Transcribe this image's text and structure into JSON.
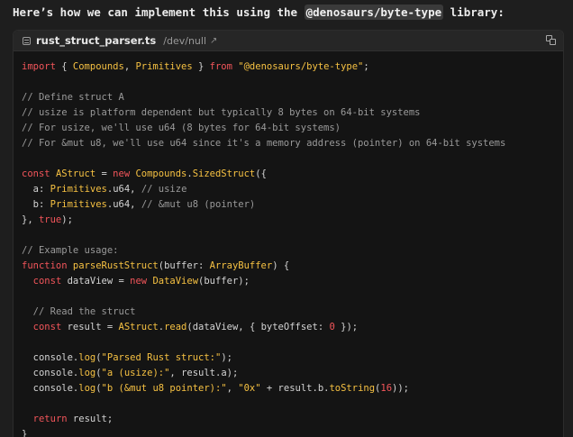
{
  "intro": {
    "before": "Here’s how we can implement this using the ",
    "package": "@denosaurs/byte-type",
    "after": " library:"
  },
  "codeblock": {
    "filename": "rust_struct_parser.ts",
    "path": "/dev/null",
    "path_icon": "external-link-icon",
    "copy_icon": "copy-icon"
  },
  "colors": {
    "keyword": "#f2555a",
    "type": "#f6c142",
    "string": "#f6c142",
    "comment": "#9a9a9a",
    "text": "#d4d4d4",
    "background": "#141414"
  },
  "code": [
    [
      [
        "kw",
        "import"
      ],
      [
        "pun",
        " { "
      ],
      [
        "ty",
        "Compounds"
      ],
      [
        "pun",
        ", "
      ],
      [
        "ty",
        "Primitives"
      ],
      [
        "pun",
        " } "
      ],
      [
        "kw",
        "from"
      ],
      [
        "pun",
        " "
      ],
      [
        "str",
        "\"@denosaurs/byte-type\""
      ],
      [
        "pun",
        ";"
      ]
    ],
    [],
    [
      [
        "com",
        "// Define struct A"
      ]
    ],
    [
      [
        "com",
        "// usize is platform dependent but typically 8 bytes on 64-bit systems"
      ]
    ],
    [
      [
        "com",
        "// For usize, we'll use u64 (8 bytes for 64-bit systems)"
      ]
    ],
    [
      [
        "com",
        "// For &mut u8, we'll use u64 since it's a memory address (pointer) on 64-bit systems"
      ]
    ],
    [],
    [
      [
        "kw",
        "const"
      ],
      [
        "pun",
        " "
      ],
      [
        "ty",
        "AStruct"
      ],
      [
        "pun",
        " = "
      ],
      [
        "kw",
        "new"
      ],
      [
        "pun",
        " "
      ],
      [
        "ty",
        "Compounds"
      ],
      [
        "pun",
        "."
      ],
      [
        "fn",
        "SizedStruct"
      ],
      [
        "pun",
        "({"
      ]
    ],
    [
      [
        "pun",
        "  "
      ],
      [
        "id",
        "a"
      ],
      [
        "pun",
        ": "
      ],
      [
        "ty",
        "Primitives"
      ],
      [
        "pun",
        "."
      ],
      [
        "id",
        "u64"
      ],
      [
        "pun",
        ", "
      ],
      [
        "com",
        "// usize"
      ]
    ],
    [
      [
        "pun",
        "  "
      ],
      [
        "id",
        "b"
      ],
      [
        "pun",
        ": "
      ],
      [
        "ty",
        "Primitives"
      ],
      [
        "pun",
        "."
      ],
      [
        "id",
        "u64"
      ],
      [
        "pun",
        ", "
      ],
      [
        "com",
        "// &mut u8 (pointer)"
      ]
    ],
    [
      [
        "pun",
        "}, "
      ],
      [
        "lit",
        "true"
      ],
      [
        "pun",
        ");"
      ]
    ],
    [],
    [
      [
        "com",
        "// Example usage:"
      ]
    ],
    [
      [
        "kw",
        "function"
      ],
      [
        "pun",
        " "
      ],
      [
        "fn",
        "parseRustStruct"
      ],
      [
        "pun",
        "("
      ],
      [
        "id",
        "buffer"
      ],
      [
        "pun",
        ": "
      ],
      [
        "ty",
        "ArrayBuffer"
      ],
      [
        "pun",
        ") {"
      ]
    ],
    [
      [
        "pun",
        "  "
      ],
      [
        "kw",
        "const"
      ],
      [
        "pun",
        " "
      ],
      [
        "id",
        "dataView"
      ],
      [
        "pun",
        " = "
      ],
      [
        "kw",
        "new"
      ],
      [
        "pun",
        " "
      ],
      [
        "ty",
        "DataView"
      ],
      [
        "pun",
        "("
      ],
      [
        "id",
        "buffer"
      ],
      [
        "pun",
        ");"
      ]
    ],
    [],
    [
      [
        "pun",
        "  "
      ],
      [
        "com",
        "// Read the struct"
      ]
    ],
    [
      [
        "pun",
        "  "
      ],
      [
        "kw",
        "const"
      ],
      [
        "pun",
        " "
      ],
      [
        "id",
        "result"
      ],
      [
        "pun",
        " = "
      ],
      [
        "ty",
        "AStruct"
      ],
      [
        "pun",
        "."
      ],
      [
        "fn",
        "read"
      ],
      [
        "pun",
        "("
      ],
      [
        "id",
        "dataView"
      ],
      [
        "pun",
        ", { "
      ],
      [
        "id",
        "byteOffset"
      ],
      [
        "pun",
        ": "
      ],
      [
        "num",
        "0"
      ],
      [
        "pun",
        " });"
      ]
    ],
    [],
    [
      [
        "pun",
        "  "
      ],
      [
        "id",
        "console"
      ],
      [
        "pun",
        "."
      ],
      [
        "fn",
        "log"
      ],
      [
        "pun",
        "("
      ],
      [
        "str",
        "\"Parsed Rust struct:\""
      ],
      [
        "pun",
        ");"
      ]
    ],
    [
      [
        "pun",
        "  "
      ],
      [
        "id",
        "console"
      ],
      [
        "pun",
        "."
      ],
      [
        "fn",
        "log"
      ],
      [
        "pun",
        "("
      ],
      [
        "str",
        "\"a (usize):\""
      ],
      [
        "pun",
        ", "
      ],
      [
        "id",
        "result"
      ],
      [
        "pun",
        "."
      ],
      [
        "id",
        "a"
      ],
      [
        "pun",
        ");"
      ]
    ],
    [
      [
        "pun",
        "  "
      ],
      [
        "id",
        "console"
      ],
      [
        "pun",
        "."
      ],
      [
        "fn",
        "log"
      ],
      [
        "pun",
        "("
      ],
      [
        "str",
        "\"b (&mut u8 pointer):\""
      ],
      [
        "pun",
        ", "
      ],
      [
        "str",
        "\"0x\""
      ],
      [
        "pun",
        " + "
      ],
      [
        "id",
        "result"
      ],
      [
        "pun",
        "."
      ],
      [
        "id",
        "b"
      ],
      [
        "pun",
        "."
      ],
      [
        "fn",
        "toString"
      ],
      [
        "pun",
        "("
      ],
      [
        "num",
        "16"
      ],
      [
        "pun",
        "));"
      ]
    ],
    [],
    [
      [
        "pun",
        "  "
      ],
      [
        "kw",
        "return"
      ],
      [
        "pun",
        " "
      ],
      [
        "id",
        "result"
      ],
      [
        "pun",
        ";"
      ]
    ],
    [
      [
        "pun",
        "}"
      ]
    ]
  ]
}
